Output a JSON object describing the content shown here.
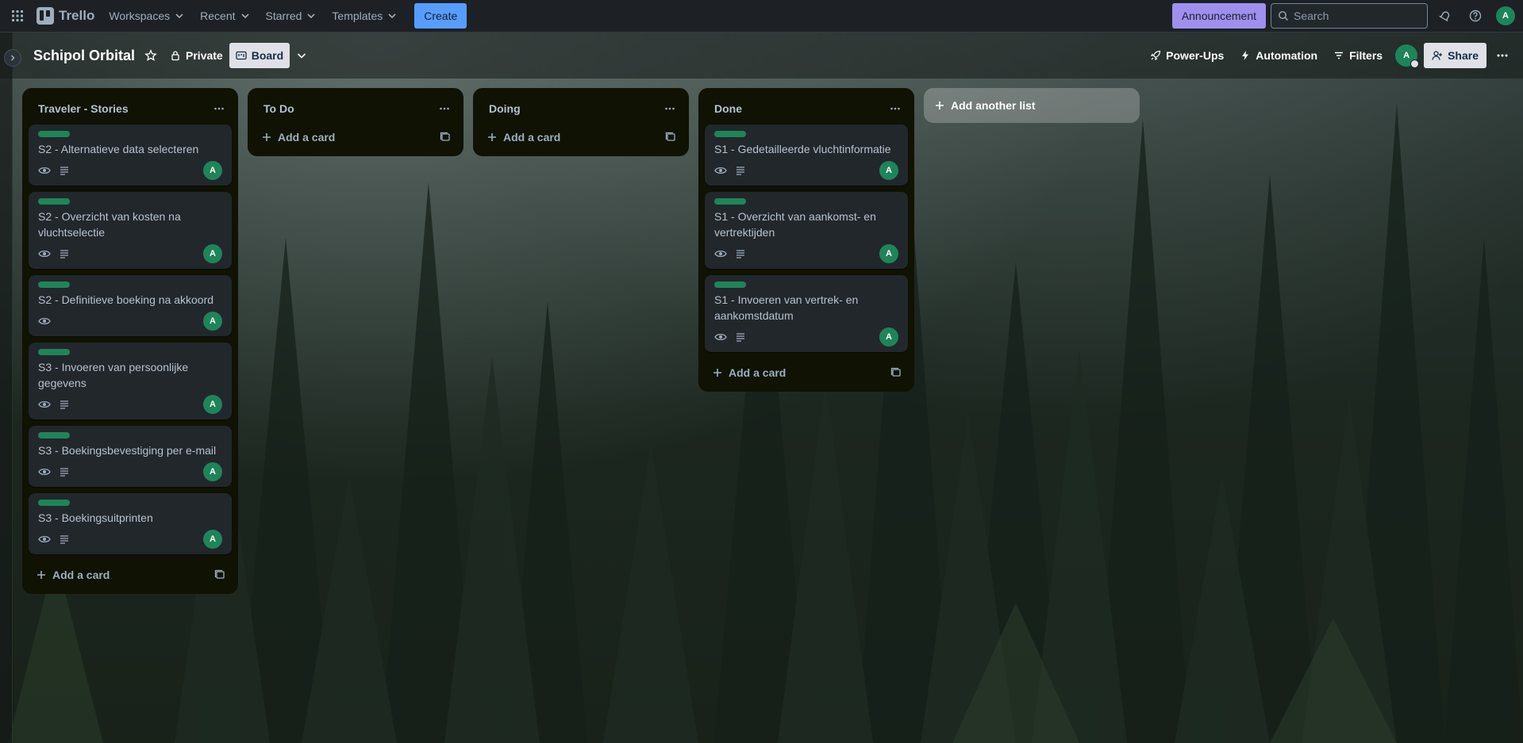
{
  "nav": {
    "logo": "Trello",
    "workspaces": "Workspaces",
    "recent": "Recent",
    "starred": "Starred",
    "templates": "Templates",
    "create": "Create",
    "announcement": "Announcement",
    "search_placeholder": "Search",
    "user_initial": "A"
  },
  "board": {
    "title": "Schipol Orbital",
    "visibility": "Private",
    "view": "Board",
    "powerups": "Power-Ups",
    "automation": "Automation",
    "filters": "Filters",
    "share": "Share",
    "member_initial": "A"
  },
  "lists": [
    {
      "title": "Traveler - Stories",
      "add_card": "Add a card",
      "cards": [
        {
          "title": "S2 - Alternatieve data selecteren",
          "watch": true,
          "description": true,
          "member": "A"
        },
        {
          "title": "S2 - Overzicht van kosten na vluchtselectie",
          "watch": true,
          "description": true,
          "member": "A"
        },
        {
          "title": "S2 - Definitieve boeking na akkoord",
          "watch": true,
          "description": false,
          "member": "A"
        },
        {
          "title": "S3 - Invoeren van persoonlijke gegevens",
          "watch": true,
          "description": true,
          "member": "A"
        },
        {
          "title": "S3 - Boekingsbevestiging per e-mail",
          "watch": true,
          "description": true,
          "member": "A"
        },
        {
          "title": "S3 - Boekingsuitprinten",
          "watch": true,
          "description": true,
          "member": "A"
        }
      ]
    },
    {
      "title": "To Do",
      "add_card": "Add a card",
      "cards": []
    },
    {
      "title": "Doing",
      "add_card": "Add a card",
      "cards": []
    },
    {
      "title": "Done",
      "add_card": "Add a card",
      "cards": [
        {
          "title": "S1 - Gedetailleerde vluchtinformatie",
          "watch": true,
          "description": true,
          "member": "A"
        },
        {
          "title": "S1 - Overzicht van aankomst- en vertrektijden",
          "watch": true,
          "description": true,
          "member": "A"
        },
        {
          "title": "S1 - Invoeren van vertrek- en aankomstdatum",
          "watch": true,
          "description": true,
          "member": "A"
        }
      ]
    }
  ],
  "add_list": "Add another list",
  "colors": {
    "label_green": "#1f845a",
    "avatar_green": "#1f845a",
    "create_blue": "#579dff",
    "announcement_purple": "#9f8fef",
    "list_bg": "#101204",
    "card_bg": "#22272b"
  }
}
